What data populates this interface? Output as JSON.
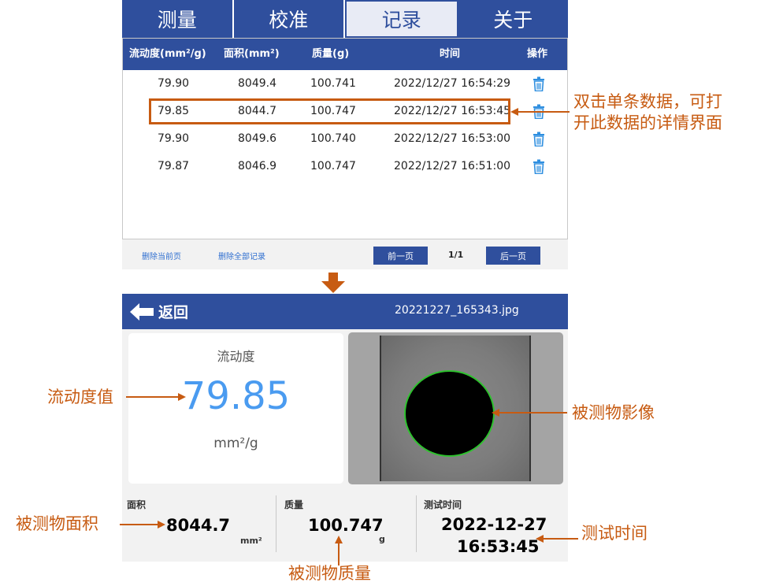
{
  "tabs": [
    {
      "label": "测量",
      "active": false
    },
    {
      "label": "校准",
      "active": false
    },
    {
      "label": "记录",
      "active": true
    },
    {
      "label": "关于",
      "active": false
    }
  ],
  "table": {
    "headers": [
      "流动度(mm²/g)",
      "面积(mm²)",
      "质量(g)",
      "时间",
      "操作"
    ],
    "rows": [
      {
        "flow": "79.90",
        "area": "8049.4",
        "mass": "100.741",
        "time": "2022/12/27 16:54:29"
      },
      {
        "flow": "79.85",
        "area": "8044.7",
        "mass": "100.747",
        "time": "2022/12/27 16:53:45"
      },
      {
        "flow": "79.90",
        "area": "8049.6",
        "mass": "100.740",
        "time": "2022/12/27 16:53:00"
      },
      {
        "flow": "79.87",
        "area": "8046.9",
        "mass": "100.747",
        "time": "2022/12/27 16:51:00"
      }
    ],
    "delete_icon": "trash-icon"
  },
  "footer": {
    "delete_page": "删除当前页",
    "delete_all": "删除全部记录",
    "prev": "前一页",
    "page": "1/1",
    "next": "后一页"
  },
  "detail": {
    "back_label": "返回",
    "filename": "20221227_165343.jpg",
    "flow_label": "流动度",
    "flow_value": "79.85",
    "flow_unit": "mm²/g",
    "area_label": "面积",
    "area_value": "8044.7",
    "area_unit": "mm²",
    "mass_label": "质量",
    "mass_value": "100.747",
    "mass_unit": "g",
    "time_label": "测试时间",
    "time_date": "2022-12-27",
    "time_clock": "16:53:45"
  },
  "annotations": {
    "row_hint_line1": "双击单条数据，可打",
    "row_hint_line2": "开此数据的详情界面",
    "flow": "流动度值",
    "image": "被测物影像",
    "area": "被测物面积",
    "mass": "被测物质量",
    "time": "测试时间"
  },
  "colors": {
    "primary": "#2f4f9d",
    "accent": "#c75b12",
    "value_blue": "#4a9bf0",
    "icon_blue": "#2f8fe0",
    "outline_green": "#2ec22e"
  }
}
